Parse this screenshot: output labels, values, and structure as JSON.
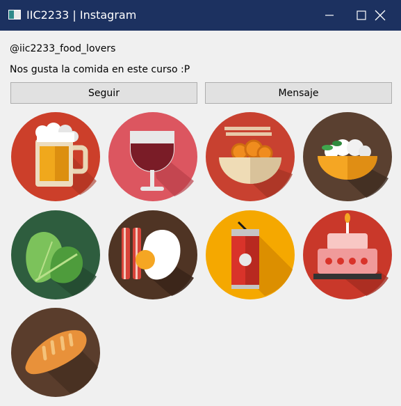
{
  "window": {
    "title": "IIC2233 | Instagram",
    "icon": "app-window-icon",
    "controls": [
      "minimize-icon",
      "maximize-icon",
      "close-icon"
    ]
  },
  "profile": {
    "handle": "@iic2233_food_lovers",
    "description": "Nos gusta la comida en este curso :P"
  },
  "buttons": {
    "follow": "Seguir",
    "message": "Mensaje"
  },
  "photos": [
    {
      "name": "beer",
      "bg": "#cc3f2a"
    },
    {
      "name": "wine",
      "bg": "#dc5660"
    },
    {
      "name": "noodles",
      "bg": "#c84130"
    },
    {
      "name": "rice-bowl",
      "bg": "#5a4030"
    },
    {
      "name": "lettuce",
      "bg": "#2e5d3e"
    },
    {
      "name": "bacon-egg",
      "bg": "#4f3424"
    },
    {
      "name": "soda-can",
      "bg": "#f5a800"
    },
    {
      "name": "cake",
      "bg": "#c9382a"
    },
    {
      "name": "bread",
      "bg": "#5a3d2c"
    }
  ],
  "colors": {
    "titlebar": "#1c3160",
    "button_bg": "#e1e1e1",
    "window_bg": "#f0f0f0"
  }
}
